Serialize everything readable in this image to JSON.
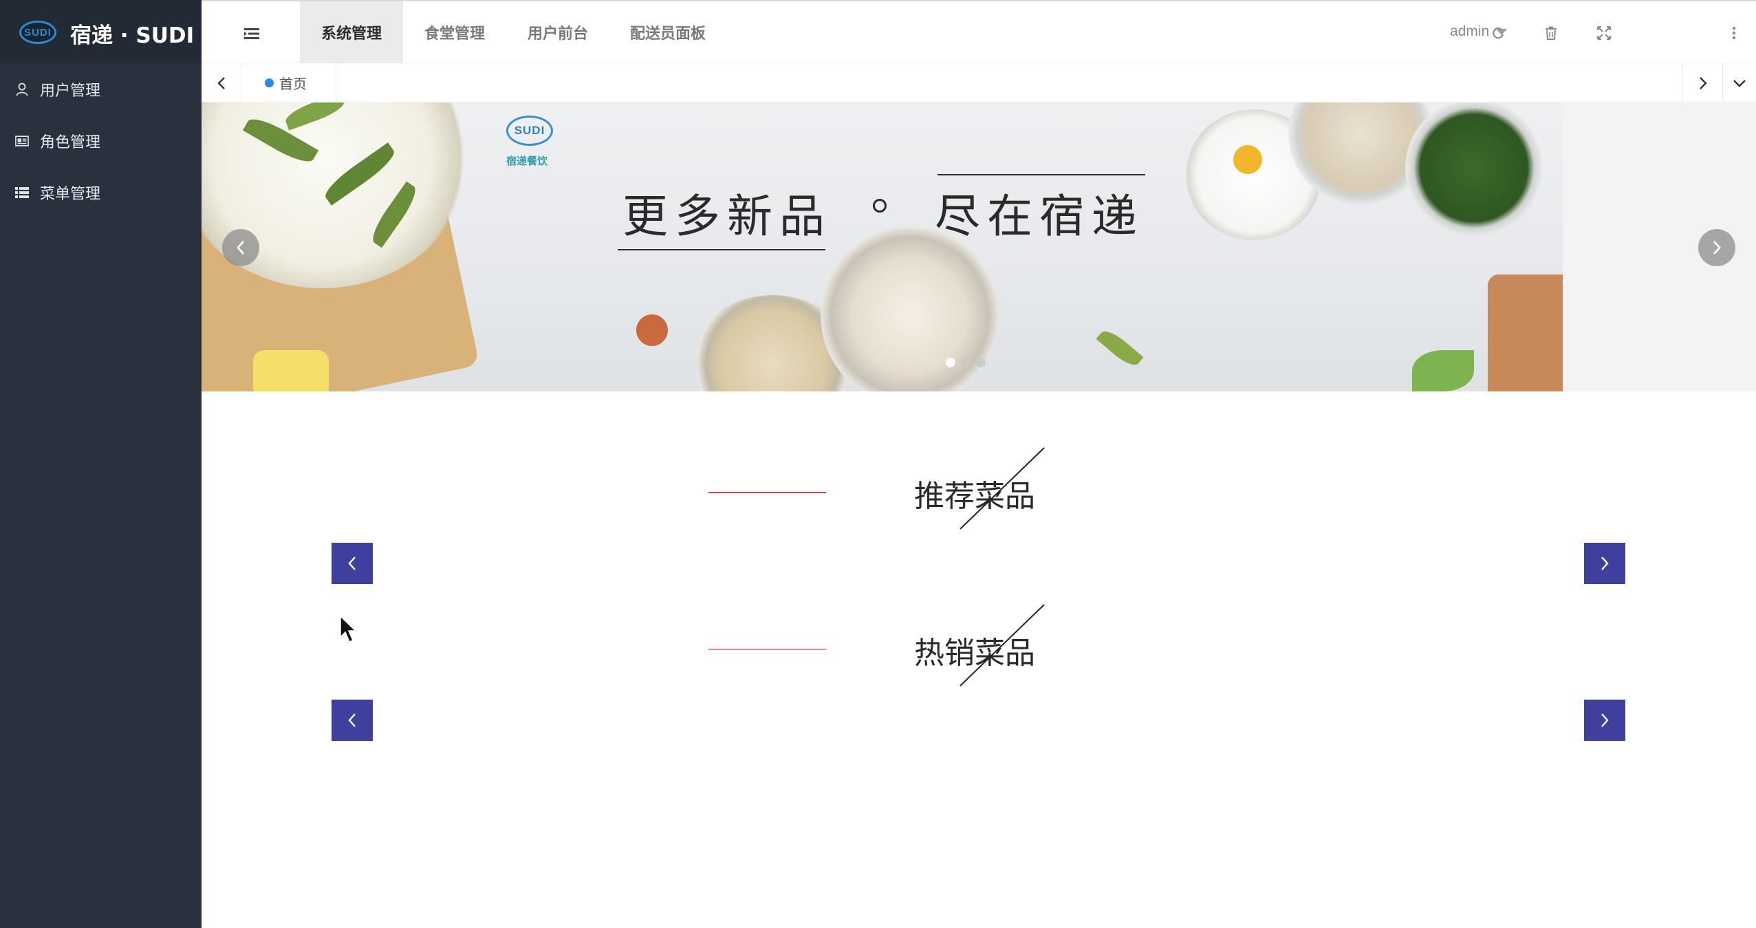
{
  "brand": {
    "badge": "SUDI",
    "title": "宿递 · SUDI"
  },
  "sidebar": {
    "items": [
      {
        "label": "用户管理",
        "icon": "user-icon"
      },
      {
        "label": "角色管理",
        "icon": "id-card-icon"
      },
      {
        "label": "菜单管理",
        "icon": "list-icon"
      }
    ]
  },
  "header": {
    "tabs": [
      {
        "label": "系统管理",
        "active": true
      },
      {
        "label": "食堂管理",
        "active": false
      },
      {
        "label": "用户前台",
        "active": false
      },
      {
        "label": "配送员面板",
        "active": false
      }
    ],
    "tools": [
      "refresh-icon",
      "trash-icon",
      "fullscreen-icon",
      "more-vertical-icon"
    ],
    "user": "admin"
  },
  "tabstrip": {
    "home_label": "首页"
  },
  "banner": {
    "logo_badge": "SUDI",
    "logo_sub": "宿递餐饮",
    "slogan_left": "更多新品",
    "slogan_right": "尽在宿递",
    "slide_count": 3,
    "active_slide": 1
  },
  "sections": [
    {
      "title": "推荐菜品"
    },
    {
      "title": "热销菜品"
    }
  ],
  "colors": {
    "sidebar_bg": "#28313d",
    "logo_bar_bg": "#222a35",
    "accent_red": "#e5394e",
    "nav_button": "#3f3f9d",
    "home_dot": "#2b8ae6"
  }
}
